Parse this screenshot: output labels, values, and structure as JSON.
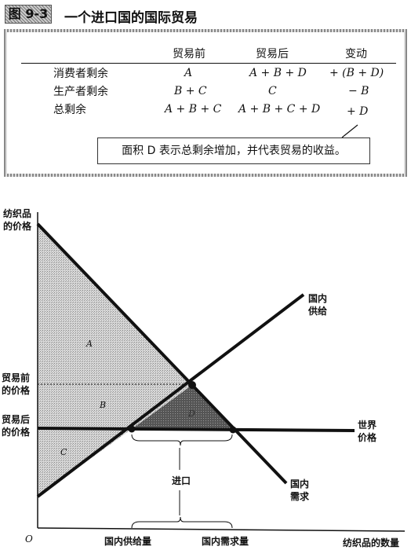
{
  "figure": {
    "number": "图 9-3",
    "title": "一个进口国的国际贸易"
  },
  "table": {
    "headers": [
      "贸易前",
      "贸易后",
      "变动"
    ],
    "rows": [
      {
        "label": "消费者剩余",
        "before": "A",
        "after": "A + B + D",
        "change": "+ (B + D)"
      },
      {
        "label": "生产者剩余",
        "before": "B + C",
        "after": "C",
        "change": "− B"
      },
      {
        "label": "总剩余",
        "before": "A + B + C",
        "after": "A + B + C + D",
        "change": "+ D"
      }
    ],
    "note": "面积 D 表示总剩余增加，并代表贸易的收益。"
  },
  "diagram": {
    "y_axis_label": [
      "纺织品",
      "的价格"
    ],
    "x_axis_label": "纺织品的数量",
    "origin": "O",
    "price_before": [
      "贸易前",
      "的价格"
    ],
    "price_after": [
      "贸易后",
      "的价格"
    ],
    "supply_label": [
      "国内",
      "供给"
    ],
    "demand_label": [
      "国内",
      "需求"
    ],
    "world_price_label": [
      "世界",
      "价格"
    ],
    "imports_label": "进口",
    "qty_supplied_label": "国内供给量",
    "qty_demanded_label": "国内需求量",
    "areas": {
      "a": "A",
      "b": "B",
      "c": "C",
      "d": "D"
    }
  }
}
